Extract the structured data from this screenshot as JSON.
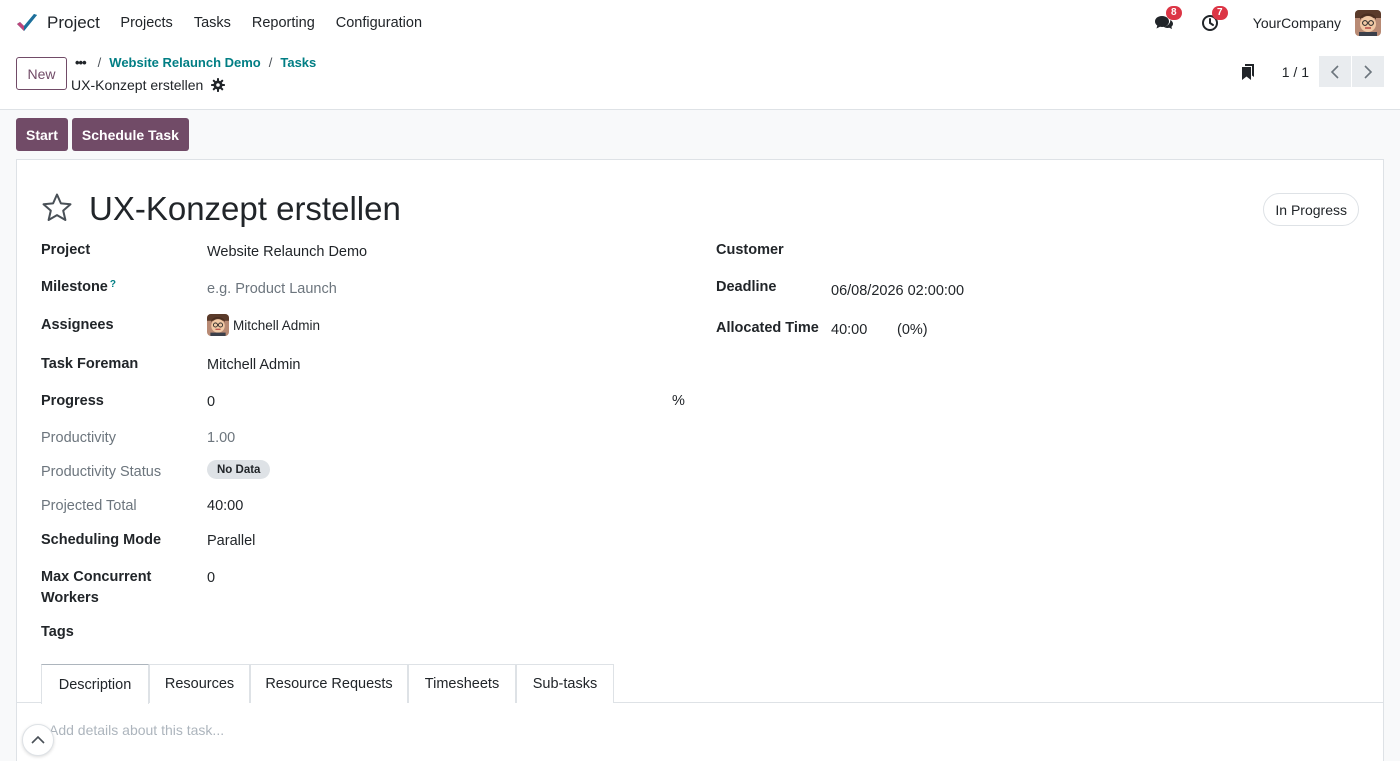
{
  "navbar": {
    "app_name": "Project",
    "menu": [
      "Projects",
      "Tasks",
      "Reporting",
      "Configuration"
    ],
    "messages_count": "8",
    "activities_count": "7",
    "company": "YourCompany"
  },
  "control_panel": {
    "new_label": "New",
    "breadcrumb": [
      "Website Relaunch Demo",
      "Tasks"
    ],
    "record_title": "UX-Konzept erstellen",
    "pager": "1 / 1"
  },
  "statusbar": {
    "start_label": "Start",
    "schedule_label": "Schedule Task"
  },
  "form": {
    "title": "UX-Konzept erstellen",
    "stage": "In Progress",
    "fields": {
      "project": {
        "label": "Project",
        "value": "Website Relaunch Demo"
      },
      "milestone": {
        "label": "Milestone",
        "help": "?",
        "placeholder": "e.g. Product Launch"
      },
      "assignees": {
        "label": "Assignees",
        "value": "Mitchell Admin"
      },
      "task_foreman": {
        "label": "Task Foreman",
        "value": "Mitchell Admin"
      },
      "progress": {
        "label": "Progress",
        "value": "0",
        "unit": "%"
      },
      "productivity": {
        "label": "Productivity",
        "value": "1.00"
      },
      "productivity_status": {
        "label": "Productivity Status",
        "value": "No Data"
      },
      "projected_total": {
        "label": "Projected Total",
        "value": "40:00"
      },
      "scheduling_mode": {
        "label": "Scheduling Mode",
        "value": "Parallel"
      },
      "max_concurrent_workers": {
        "label_line1": "Max Concurrent",
        "label_line2": "Workers",
        "value": "0"
      },
      "tags": {
        "label": "Tags"
      },
      "customer": {
        "label": "Customer"
      },
      "deadline": {
        "label": "Deadline",
        "value": "06/08/2026 02:00:00"
      },
      "allocated_time": {
        "label": "Allocated Time",
        "value": "40:00",
        "percent": "(0%)"
      }
    },
    "tabs": [
      "Description",
      "Resources",
      "Resource Requests",
      "Timesheets",
      "Sub-tasks"
    ],
    "description_placeholder": "Add details about this task..."
  },
  "colors": {
    "brand": "#714b67",
    "link": "#017e84",
    "badge": "#dc3545"
  }
}
